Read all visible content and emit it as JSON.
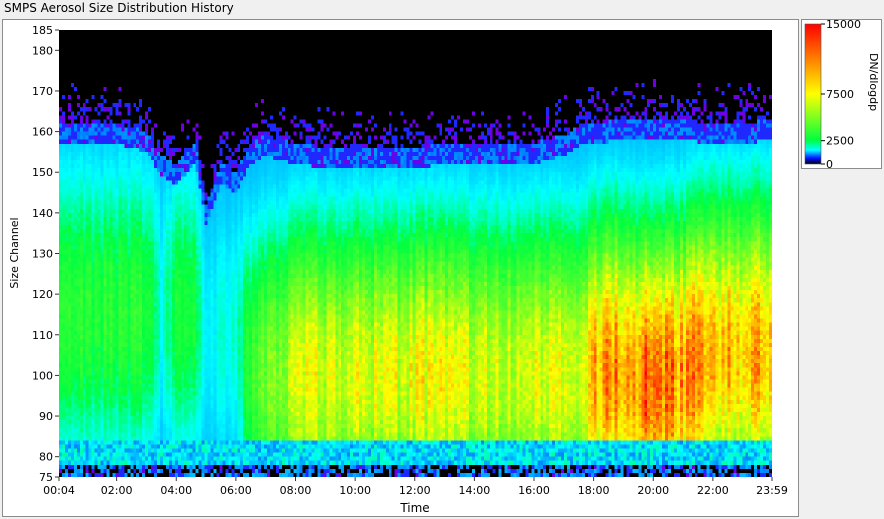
{
  "window": {
    "title": "SMPS Aerosol Size Distribution History"
  },
  "chart_data": {
    "type": "heatmap",
    "title": "SMPS Aerosol Size Distribution History",
    "xlabel": "Time",
    "ylabel": "Size Channel",
    "x_ticks": [
      "00:04",
      "02:00",
      "04:00",
      "06:00",
      "08:00",
      "10:00",
      "12:00",
      "14:00",
      "16:00",
      "18:00",
      "20:00",
      "22:00",
      "23:59"
    ],
    "x_tick_minutes": [
      4,
      120,
      240,
      360,
      480,
      600,
      720,
      840,
      960,
      1080,
      1200,
      1320,
      1439
    ],
    "xlim_minutes": [
      4,
      1439
    ],
    "y_ticks": [
      75,
      80,
      90,
      100,
      110,
      120,
      130,
      140,
      150,
      160,
      170,
      180,
      185
    ],
    "ylim": [
      75,
      185
    ],
    "colorbar": {
      "label": "DN/dlogdp",
      "ticks": [
        "15000",
        "7500",
        "2500",
        "0"
      ],
      "tick_values": [
        15000,
        7500,
        2500,
        0
      ],
      "range": [
        0,
        15000
      ]
    },
    "profile": {
      "time_minutes": [
        4,
        60,
        120,
        180,
        210,
        240,
        280,
        300,
        330,
        360,
        390,
        420,
        480,
        540,
        600,
        660,
        720,
        780,
        840,
        900,
        960,
        1020,
        1060,
        1080,
        1140,
        1200,
        1260,
        1320,
        1380,
        1439
      ],
      "top_channel": [
        160,
        160,
        160,
        158,
        152,
        150,
        155,
        140,
        150,
        148,
        155,
        157,
        155,
        154,
        154,
        154,
        154,
        155,
        155,
        155,
        155,
        157,
        160,
        160,
        161,
        161,
        161,
        160,
        160,
        161
      ],
      "peak_dndlogdp": [
        2200,
        2200,
        2300,
        2300,
        800,
        1800,
        2000,
        500,
        700,
        800,
        2500,
        3500,
        5500,
        6000,
        6000,
        5800,
        6500,
        6500,
        5500,
        5500,
        6000,
        5500,
        5500,
        9000,
        10000,
        11000,
        9500,
        9000,
        8000,
        9000
      ],
      "peak_channel": [
        115,
        115,
        115,
        115,
        115,
        115,
        115,
        110,
        110,
        110,
        100,
        100,
        100,
        100,
        100,
        100,
        100,
        100,
        100,
        100,
        100,
        100,
        100,
        100,
        100,
        97,
        100,
        105,
        105,
        105
      ]
    }
  }
}
